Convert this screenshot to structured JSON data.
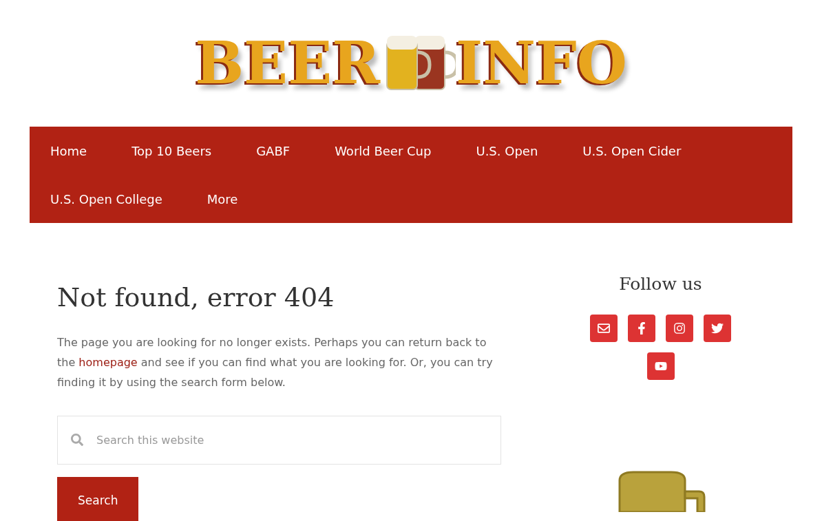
{
  "logo": {
    "words": [
      "BEER",
      "INFO"
    ]
  },
  "nav": {
    "items": [
      {
        "label": "Home"
      },
      {
        "label": "Top 10 Beers"
      },
      {
        "label": "GABF"
      },
      {
        "label": "World Beer Cup"
      },
      {
        "label": "U.S. Open"
      },
      {
        "label": "U.S. Open Cider"
      },
      {
        "label": "U.S. Open College"
      },
      {
        "label": "More"
      }
    ]
  },
  "main": {
    "title": "Not found, error 404",
    "text_before": "The page you are looking for no longer exists. Perhaps you can return back to the",
    "link": "homepage",
    "text_after": "and see if you can find what you are looking for. Or, you can try finding it by using the search form below.",
    "search": {
      "placeholder": "Search this website"
    },
    "button": "Search"
  },
  "sidebar": {
    "title": "Follow us",
    "social": [
      {
        "kind": "email"
      },
      {
        "kind": "facebook"
      },
      {
        "kind": "instagram"
      },
      {
        "kind": "twitter"
      },
      {
        "kind": "youtube"
      }
    ]
  }
}
